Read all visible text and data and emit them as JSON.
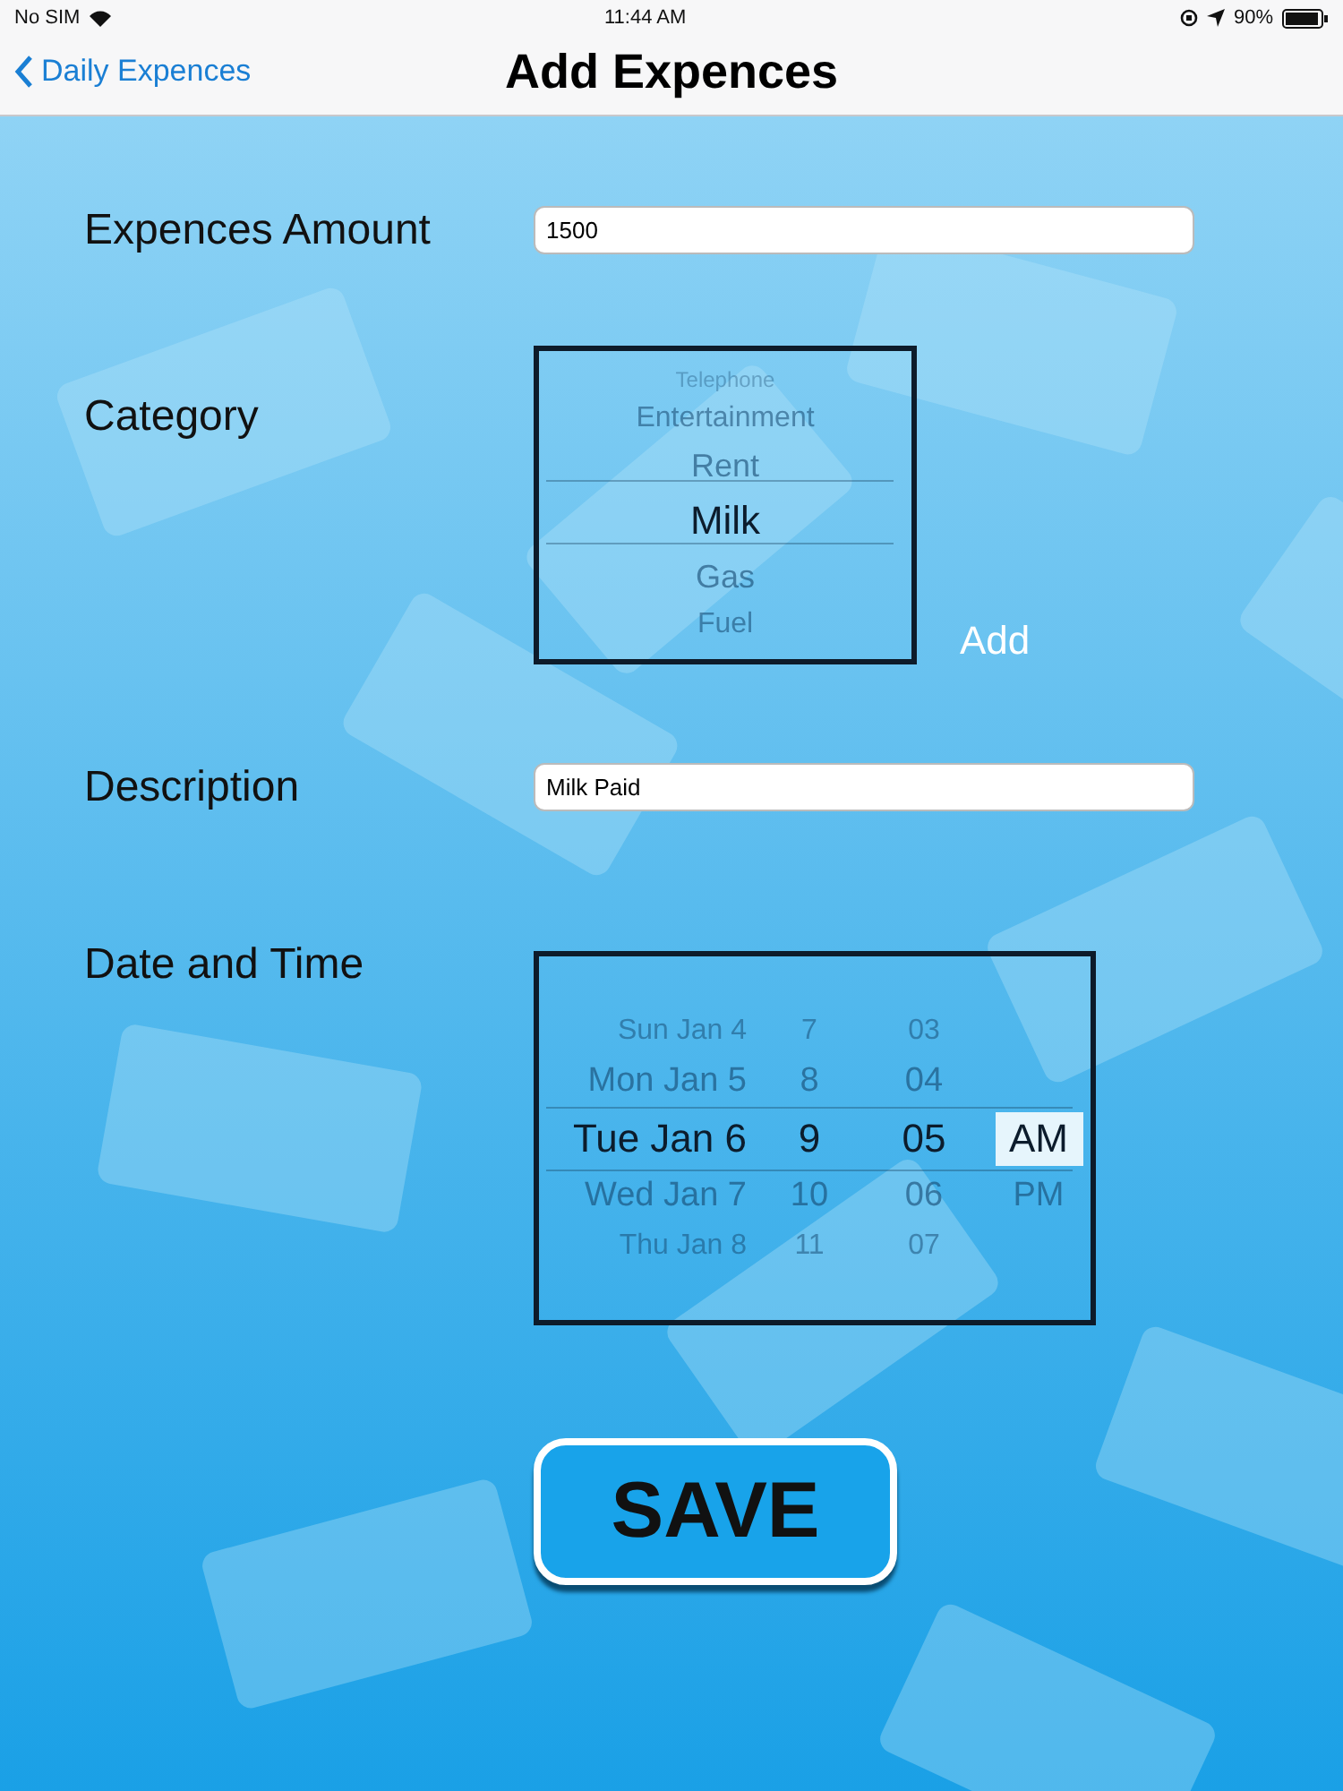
{
  "status_bar": {
    "carrier": "No SIM",
    "time": "11:44 AM",
    "battery": "90%"
  },
  "nav": {
    "back": "Daily Expences",
    "title": "Add Expences"
  },
  "amount": {
    "label": "Expences Amount",
    "value": "1500"
  },
  "category": {
    "label": "Category",
    "options": [
      {
        "label": "Telephone",
        "selected": false
      },
      {
        "label": "Entertainment",
        "selected": false
      },
      {
        "label": "Rent",
        "selected": false
      },
      {
        "label": "Milk",
        "selected": true
      },
      {
        "label": "Gas",
        "selected": false
      },
      {
        "label": "Fuel",
        "selected": false
      }
    ],
    "add_button": "Add"
  },
  "description": {
    "label": "Description",
    "value": "Milk Paid"
  },
  "date_time": {
    "label": "Date and Time",
    "columns": [
      {
        "kind": "day",
        "items": [
          {
            "label": "Sun Jan 4",
            "selected": false
          },
          {
            "label": "Mon Jan 5",
            "selected": false
          },
          {
            "label": "Tue Jan 6",
            "selected": true
          },
          {
            "label": "Wed Jan 7",
            "selected": false
          },
          {
            "label": "Thu Jan 8",
            "selected": false
          }
        ]
      },
      {
        "kind": "hour",
        "items": [
          {
            "label": "7",
            "selected": false
          },
          {
            "label": "8",
            "selected": false
          },
          {
            "label": "9",
            "selected": true
          },
          {
            "label": "10",
            "selected": false
          },
          {
            "label": "11",
            "selected": false
          }
        ]
      },
      {
        "kind": "minute",
        "items": [
          {
            "label": "03",
            "selected": false
          },
          {
            "label": "04",
            "selected": false
          },
          {
            "label": "05",
            "selected": true
          },
          {
            "label": "06",
            "selected": false
          },
          {
            "label": "07",
            "selected": false
          }
        ]
      },
      {
        "kind": "meridiem",
        "items": [
          {
            "label": "AM",
            "selected": true
          },
          {
            "label": "PM",
            "selected": false
          }
        ]
      }
    ]
  },
  "save_button": "SAVE"
}
